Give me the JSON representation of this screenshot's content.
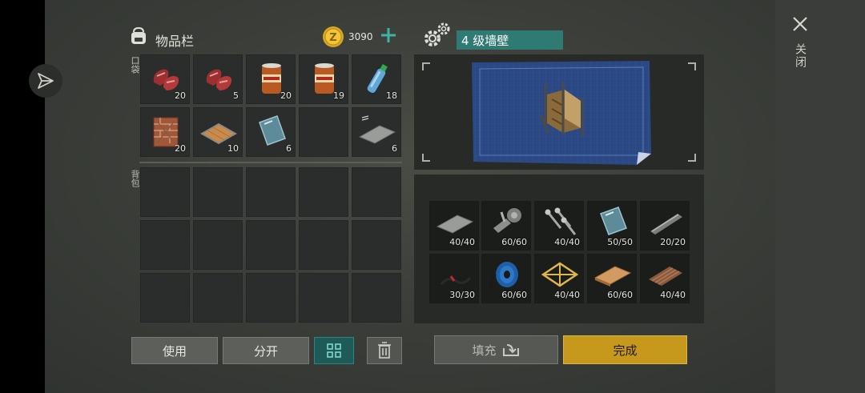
{
  "inventory": {
    "title": "物品栏",
    "coins": "3090",
    "pocket_label": "口袋",
    "backpack_label": "背包",
    "pocket_items": [
      {
        "icon": "raw-meat-icon",
        "count": "20"
      },
      {
        "icon": "raw-meat-icon",
        "count": "5"
      },
      {
        "icon": "canned-food-icon",
        "count": "20"
      },
      {
        "icon": "canned-food-icon",
        "count": "19"
      },
      {
        "icon": "water-bottle-icon",
        "count": "18"
      },
      {
        "icon": "brick-wall-icon",
        "count": "20"
      },
      {
        "icon": "wooden-floor-icon",
        "count": "10"
      },
      {
        "icon": "glass-pane-icon",
        "count": "6"
      },
      {
        "icon": "empty",
        "count": ""
      },
      {
        "icon": "metal-sheet-icon",
        "count": "6"
      }
    ]
  },
  "buttons": {
    "use": "使用",
    "split": "分开",
    "fill": "填充",
    "done": "完成"
  },
  "close": {
    "label": "关闭"
  },
  "craft": {
    "title": "4 级墙壁",
    "materials": [
      {
        "icon": "metal-sheet-icon",
        "count": "40/40"
      },
      {
        "icon": "hinge-icon",
        "count": "60/60"
      },
      {
        "icon": "screws-icon",
        "count": "40/40"
      },
      {
        "icon": "glass-pane-icon",
        "count": "50/50"
      },
      {
        "icon": "metal-rod-icon",
        "count": "20/20"
      },
      {
        "icon": "wires-icon",
        "count": "30/30"
      },
      {
        "icon": "cable-spool-icon",
        "count": "60/60"
      },
      {
        "icon": "truss-frame-icon",
        "count": "40/40"
      },
      {
        "icon": "plywood-icon",
        "count": "60/60"
      },
      {
        "icon": "corrugated-metal-icon",
        "count": "40/40"
      }
    ]
  },
  "colors": {
    "accent_teal": "#2f7a73",
    "done_gold": "#c6991d",
    "plus_teal": "#3fb3a6"
  }
}
